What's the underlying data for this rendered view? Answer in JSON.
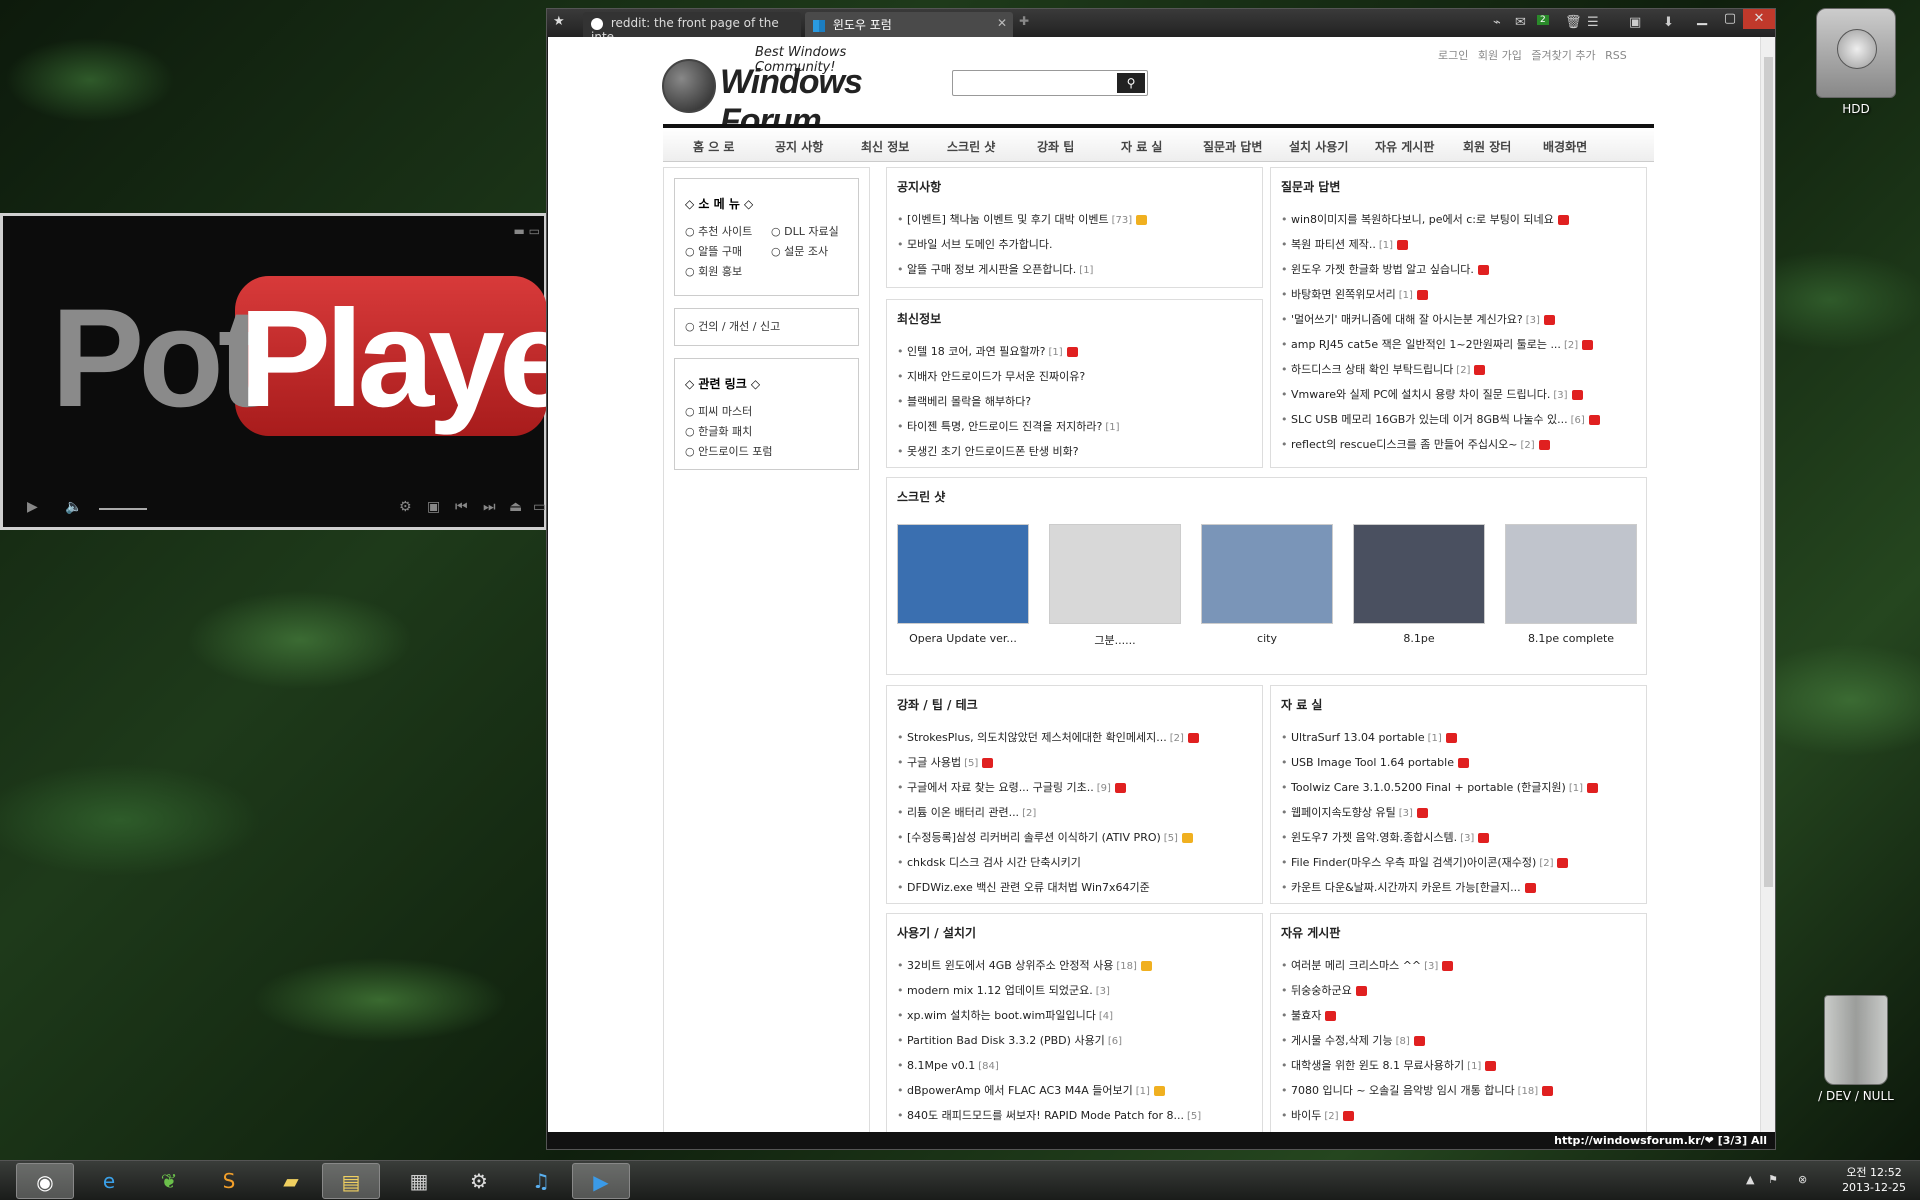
{
  "desktop": {
    "hdd_label": "HDD",
    "trash_label": "/ DEV / NULL"
  },
  "potplayer": {
    "logo_word1": "Pot",
    "logo_word2": "Player"
  },
  "browser": {
    "tabs": [
      {
        "label": "reddit: the front page of the inte..."
      },
      {
        "label": "윈도우 포럼"
      }
    ],
    "status_text": "http://windowsforum.kr/❤ [3/3] All"
  },
  "site": {
    "tagline": "Best Windows Community!",
    "name": "Windows Forum",
    "top_links": [
      "로그인",
      "회원 가입",
      "즐겨찾기 추가",
      "RSS"
    ],
    "nav": [
      "홈 으 로",
      "공지 사항",
      "최신 정보",
      "스크린 샷",
      "강좌 팁",
      "자 료 실",
      "질문과 답변",
      "설치 사용기",
      "자유 게시판",
      "회원 장터",
      "배경화면"
    ],
    "small_menu": {
      "title": "◇ 소 메 뉴 ◇",
      "col1": [
        "추천 사이트",
        "알뜰 구매",
        "회원 홍보"
      ],
      "col2": [
        "DLL 자료실",
        "설문 조사"
      ]
    },
    "suggest": "건의 / 개선 / 신고",
    "related": {
      "title": "◇ 관련 링크 ◇",
      "items": [
        "피씨 마스터",
        "한글화 패치",
        "안드로이드 포럼"
      ]
    },
    "notice": {
      "title": "공지사항",
      "items": [
        {
          "text": "[이벤트] 책나눔 이벤트 및 후기 대박 이벤트",
          "count": "[73]",
          "badge": "hot"
        },
        {
          "text": "모바일 서브 도메인 추가합니다.",
          "count": "",
          "badge": ""
        },
        {
          "text": "알뜰 구매 정보 게시판을 오픈합니다.",
          "count": "[1]",
          "badge": ""
        }
      ]
    },
    "qna": {
      "title": "질문과 답변",
      "items": [
        {
          "text": "win8이미지를 복원하다보니, pe에서 c:로 부팅이 되네요",
          "count": "",
          "badge": "new"
        },
        {
          "text": "복원 파티션 제작..",
          "count": "[1]",
          "badge": "new"
        },
        {
          "text": "윈도우 가젯 한글화 방법 알고 싶습니다.",
          "count": "",
          "badge": "new"
        },
        {
          "text": "바탕화면 왼쪽위모서리",
          "count": "[1]",
          "badge": "new"
        },
        {
          "text": "'멀어쓰기' 매커니즘에 대해 잘 아시는분 계신가요?",
          "count": "[3]",
          "badge": "new"
        },
        {
          "text": "amp RJ45 cat5e 잭은 일반적인 1~2만원짜리 툴로는 ...",
          "count": "[2]",
          "badge": "new"
        },
        {
          "text": "하드디스크 상태 확인 부탁드립니다",
          "count": "[2]",
          "badge": "new"
        },
        {
          "text": "Vmware와 실제 PC에 설치시 용량 차이 질문 드립니다.",
          "count": "[3]",
          "badge": "new"
        },
        {
          "text": "SLC USB 메모리 16GB가 있는데 이거 8GB씩 나눌수 있...",
          "count": "[6]",
          "badge": "new"
        },
        {
          "text": "reflect의 rescue디스크를 좀 만들어 주십시오~",
          "count": "[2]",
          "badge": "new"
        }
      ]
    },
    "latest": {
      "title": "최신정보",
      "items": [
        {
          "text": "인텔 18 코어, 과연 필요할까?",
          "count": "[1]",
          "badge": "new"
        },
        {
          "text": "지배자 안드로이드가 무서운 진짜이유?",
          "count": "",
          "badge": ""
        },
        {
          "text": "블랙베리 몰락을 해부하다?",
          "count": "",
          "badge": ""
        },
        {
          "text": "타이젠 특명, 안드로이드 진격을 저지하라?",
          "count": "[1]",
          "badge": ""
        },
        {
          "text": "못생긴 초기 안드로이드폰 탄생 비화?",
          "count": "",
          "badge": ""
        }
      ]
    },
    "screenshots": {
      "title": "스크린 샷",
      "items": [
        {
          "caption": "Opera Update ver...",
          "color": "#3a6fb0"
        },
        {
          "caption": "그분......",
          "color": "#d8d8d8"
        },
        {
          "caption": "city",
          "color": "#7a95b8"
        },
        {
          "caption": "8.1pe",
          "color": "#4a5060"
        },
        {
          "caption": "8.1pe complete",
          "color": "#c0c4cc"
        }
      ]
    },
    "tips": {
      "title": "강좌 / 팁 / 테크",
      "items": [
        {
          "text": "StrokesPlus, 의도치않았던 제스처에대한 확인메세지...",
          "count": "[2]",
          "badge": "new"
        },
        {
          "text": "구글 사용법",
          "count": "[5]",
          "badge": "new"
        },
        {
          "text": "구글에서 자료 찾는 요령... 구글링 기초..",
          "count": "[9]",
          "badge": "new"
        },
        {
          "text": "리튬 이온 배터리 관련...",
          "count": "[2]",
          "badge": ""
        },
        {
          "text": "[수정등록]삼성 리커버리 솔루션 이식하기 (ATIV PRO)",
          "count": "[5]",
          "badge": "hot"
        },
        {
          "text": "chkdsk 디스크 검사 시간 단축시키기",
          "count": "",
          "badge": ""
        },
        {
          "text": "DFDWiz.exe 백신 관련 오류 대처법 Win7x64기준",
          "count": "",
          "badge": ""
        }
      ]
    },
    "pds": {
      "title": "자 료 실",
      "items": [
        {
          "text": "UltraSurf 13.04 portable",
          "count": "[1]",
          "badge": "new"
        },
        {
          "text": "USB Image Tool 1.64 portable",
          "count": "",
          "badge": "new"
        },
        {
          "text": "Toolwiz Care 3.1.0.5200 Final + portable (한글지원)",
          "count": "[1]",
          "badge": "new"
        },
        {
          "text": "웹페이지속도향상 유틸",
          "count": "[3]",
          "badge": "new"
        },
        {
          "text": "윈도우7 가젯 음악.영화.종합시스템.",
          "count": "[3]",
          "badge": "new"
        },
        {
          "text": "File Finder(마우스 우측 파일 검색기)아이콘(재수정)",
          "count": "[2]",
          "badge": "new"
        },
        {
          "text": "카운트 다운&날짜.시간까지 카운트 가능[한글지...",
          "count": "",
          "badge": "new"
        }
      ]
    },
    "review": {
      "title": "사용기 / 설치기",
      "items": [
        {
          "text": "32비트 윈도에서 4GB 상위주소 안정적 사용",
          "count": "[18]",
          "badge": "hot"
        },
        {
          "text": "modern mix 1.12 업데이트 되었군요.",
          "count": "[3]",
          "badge": ""
        },
        {
          "text": "xp.wim 설치하는 boot.wim파일입니다",
          "count": "[4]",
          "badge": ""
        },
        {
          "text": "Partition Bad Disk 3.3.2 (PBD) 사용기",
          "count": "[6]",
          "badge": ""
        },
        {
          "text": "8.1Mpe v0.1",
          "count": "[84]",
          "badge": ""
        },
        {
          "text": "dBpowerAmp 에서 FLAC AC3 M4A 들어보기",
          "count": "[1]",
          "badge": "hot"
        },
        {
          "text": "840도 래피드모드를 써보자! RAPID Mode Patch for 8...",
          "count": "[5]",
          "badge": ""
        }
      ]
    },
    "free": {
      "title": "자유 게시판",
      "items": [
        {
          "text": "여러분 메리 크리스마스 ^^",
          "count": "[3]",
          "badge": "new"
        },
        {
          "text": "뒤숭숭하군요",
          "count": "",
          "badge": "new"
        },
        {
          "text": "불효자",
          "count": "",
          "badge": "new"
        },
        {
          "text": "게시물 수정,삭제 기능",
          "count": "[8]",
          "badge": "new"
        },
        {
          "text": "대학생을 위한 윈도 8.1 무료사용하기",
          "count": "[1]",
          "badge": "new"
        },
        {
          "text": "7080 입니다 ~ 오솔길 음악방 임시 개통 합니다",
          "count": "[18]",
          "badge": "new"
        },
        {
          "text": "바이두",
          "count": "[2]",
          "badge": "new"
        }
      ]
    }
  },
  "taskbar": {
    "time": "오전 12:52",
    "date": "2013-12-25"
  }
}
